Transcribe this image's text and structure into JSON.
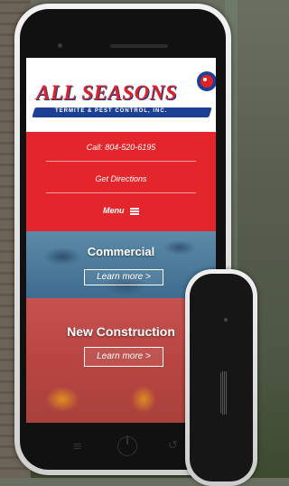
{
  "site": {
    "logo": {
      "name": "ALL SEASONS",
      "tagline": "TERMITE & PEST CONTROL, INC."
    }
  },
  "nav": {
    "phone_label": "Call: 804-520-6195",
    "directions_label": "Get Directions",
    "menu_label": "Menu"
  },
  "panels": [
    {
      "title": "Commercial",
      "button_label": "Learn more >"
    },
    {
      "title": "New Construction",
      "button_label": "Learn more >"
    }
  ],
  "colors": {
    "brand_red": "#e4262c",
    "brand_blue": "#1d4094"
  },
  "icons": {
    "menu": "hamburger-icon",
    "recent": "recent-apps-icon",
    "home": "power-icon",
    "back": "back-icon"
  }
}
